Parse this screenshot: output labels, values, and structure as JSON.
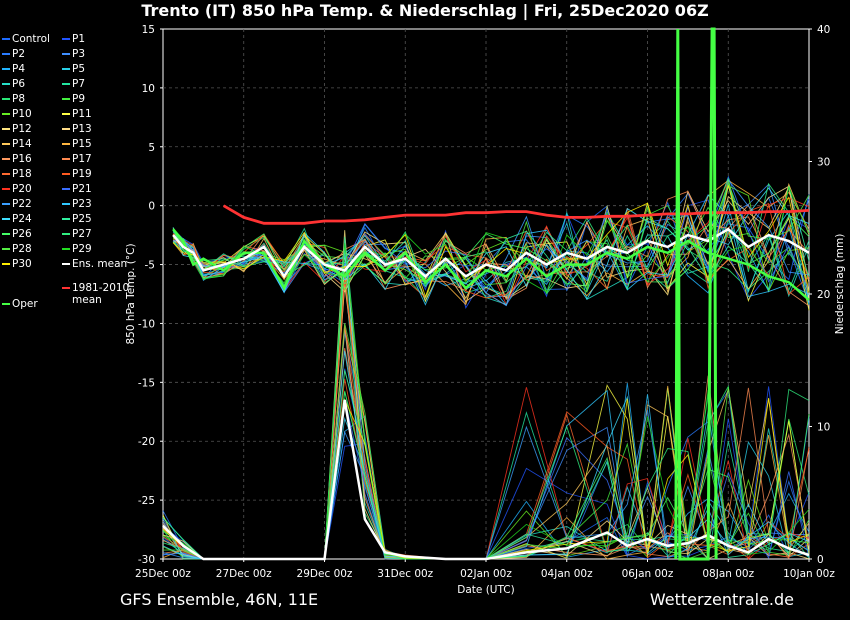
{
  "title": "Trento  (IT)  850 hPa Temp. & Niederschlag | Fri, 25Dec2020 06Z",
  "footer_left": "GFS Ensemble, 46N, 11E",
  "footer_right": "Wetterzentrale.de",
  "legend": [
    {
      "label": "Control",
      "color": "#1e6cff"
    },
    {
      "label": "P1",
      "color": "#2255ff"
    },
    {
      "label": "P2",
      "color": "#2a7cff"
    },
    {
      "label": "P3",
      "color": "#3f8fff"
    },
    {
      "label": "P4",
      "color": "#22b4ff"
    },
    {
      "label": "P5",
      "color": "#2ad0e8"
    },
    {
      "label": "P6",
      "color": "#26e0c8"
    },
    {
      "label": "P7",
      "color": "#22e6a0"
    },
    {
      "label": "P8",
      "color": "#2ae878"
    },
    {
      "label": "P9",
      "color": "#44f040"
    },
    {
      "label": "P10",
      "color": "#66ee22"
    },
    {
      "label": "P11",
      "color": "#ffff44"
    },
    {
      "label": "P12",
      "color": "#ffe680"
    },
    {
      "label": "P13",
      "color": "#ffdd88"
    },
    {
      "label": "P14",
      "color": "#ffc85a"
    },
    {
      "label": "P15",
      "color": "#ffb640"
    },
    {
      "label": "P16",
      "color": "#ff9a60"
    },
    {
      "label": "P17",
      "color": "#ff8a50"
    },
    {
      "label": "P18",
      "color": "#ff6a30"
    },
    {
      "label": "P19",
      "color": "#ff5a20"
    },
    {
      "label": "P20",
      "color": "#ff3320"
    },
    {
      "label": "P21",
      "color": "#3b6fff"
    },
    {
      "label": "P22",
      "color": "#3b9fff"
    },
    {
      "label": "P23",
      "color": "#30c8ff"
    },
    {
      "label": "P24",
      "color": "#40e0ff"
    },
    {
      "label": "P25",
      "color": "#30f0a0"
    },
    {
      "label": "P26",
      "color": "#44ff66"
    },
    {
      "label": "P27",
      "color": "#30ee80"
    },
    {
      "label": "P28",
      "color": "#55ee44"
    },
    {
      "label": "P29",
      "color": "#22dd22"
    },
    {
      "label": "P30",
      "color": "#ffee00"
    },
    {
      "label": "Ens. mean",
      "color": "#ffffff"
    },
    {
      "label": "1981-2010 mean",
      "color": "#ff3333"
    },
    {
      "label": "Oper",
      "color": "#44ff44"
    }
  ],
  "chart_data": {
    "type": "line",
    "xlabel": "Date (UTC)",
    "ylabel": "850 hPa Temp. (°C)",
    "ylabel2": "Niederschlag (mm)",
    "ylim": [
      -30,
      15
    ],
    "ylim2": [
      0,
      40
    ],
    "yticks": [
      "15",
      "10",
      "5",
      "0",
      "-5",
      "-10",
      "-15",
      "-20",
      "-25",
      "-30"
    ],
    "yticks2": [
      "40",
      "30",
      "20",
      "10",
      "0"
    ],
    "xticks": [
      "25Dec 00z",
      "27Dec 00z",
      "29Dec 00z",
      "31Dec 00z",
      "02Jan 00z",
      "04Jan 00z",
      "06Jan 00z",
      "08Jan 00z",
      "10Jan 00z"
    ],
    "x_days_range": [
      0,
      16
    ],
    "grid": true,
    "series": [
      {
        "name": "Ens. mean",
        "axis": "temp",
        "color": "#ffffff",
        "x": [
          0.25,
          0.5,
          0.75,
          1,
          1.5,
          2,
          2.5,
          3,
          3.5,
          4,
          4.5,
          5,
          5.5,
          6,
          6.5,
          7,
          7.5,
          8,
          8.5,
          9,
          9.5,
          10,
          10.5,
          11,
          11.5,
          12,
          12.5,
          13,
          13.5,
          14,
          14.5,
          15,
          15.5,
          16
        ],
        "values": [
          -2.5,
          -3.5,
          -4,
          -5.5,
          -5,
          -4.5,
          -3.5,
          -6,
          -3.5,
          -5,
          -5.5,
          -3.5,
          -5,
          -4.5,
          -6,
          -4.5,
          -6,
          -5,
          -5.5,
          -4,
          -5,
          -4,
          -4.5,
          -3.5,
          -4,
          -3,
          -3.5,
          -2.5,
          -3,
          -2,
          -3.5,
          -2.5,
          -3,
          -4
        ]
      },
      {
        "name": "Oper",
        "axis": "temp",
        "color": "#44ff44",
        "x": [
          0.25,
          0.5,
          0.75,
          1,
          1.5,
          2,
          2.5,
          3,
          3.5,
          4,
          4.5,
          5,
          5.5,
          6,
          6.5,
          7,
          7.5,
          8,
          8.5,
          9,
          9.5,
          10,
          10.5,
          11,
          11.5,
          12,
          12.5,
          13,
          13.5,
          14,
          14.5,
          15,
          15.5,
          16
        ],
        "values": [
          -2,
          -3,
          -5,
          -4.5,
          -5.5,
          -4,
          -4,
          -7,
          -3,
          -5,
          -6,
          -4,
          -5.5,
          -4,
          -6.5,
          -5,
          -7,
          -5.5,
          -6,
          -4.5,
          -6,
          -5,
          -5,
          -4,
          -4.5,
          -3.5,
          -4,
          -3,
          -4,
          -4.5,
          -5,
          -6,
          -6.5,
          -8
        ]
      },
      {
        "name": "1981-2010 mean",
        "axis": "temp",
        "color": "#ff3333",
        "x": [
          1.5,
          2,
          2.5,
          3,
          3.5,
          4,
          4.5,
          5,
          5.5,
          6,
          6.5,
          7,
          7.5,
          8,
          8.5,
          9,
          9.5,
          10,
          10.5,
          11,
          11.5,
          12,
          12.5,
          13,
          13.5,
          14,
          14.5,
          15,
          15.5,
          16
        ],
        "values": [
          0,
          -1,
          -1.5,
          -1.5,
          -1.5,
          -1.3,
          -1.3,
          -1.2,
          -1,
          -0.8,
          -0.8,
          -0.8,
          -0.6,
          -0.6,
          -0.5,
          -0.5,
          -0.8,
          -1,
          -1,
          -0.9,
          -0.9,
          -0.8,
          -0.7,
          -0.7,
          -0.6,
          -0.6,
          -0.6,
          -0.5,
          -0.5,
          -0.4
        ]
      },
      {
        "name": "Ens. mean",
        "axis": "precip",
        "color": "#ffffff",
        "x": [
          0,
          0.5,
          1,
          2,
          3,
          4,
          4.5,
          5,
          5.5,
          6,
          7,
          8,
          9,
          10,
          11,
          11.5,
          12,
          12.5,
          13,
          13.5,
          14,
          14.5,
          15,
          15.5,
          16
        ],
        "values": [
          2.5,
          1,
          0,
          0,
          0,
          0,
          12,
          3,
          0.5,
          0.2,
          0,
          0,
          0.5,
          0.8,
          2,
          1,
          1.5,
          1,
          1.2,
          1.8,
          1,
          0.5,
          1.5,
          0.8,
          0.3
        ]
      }
    ],
    "ensemble_members": 30,
    "spike_series": [
      {
        "name": "Oper",
        "axis": "precip",
        "color": "#44ff44",
        "x": [
          12.7,
          12.75,
          12.8,
          13.5,
          13.6,
          13.65,
          13.7
        ],
        "values": [
          0,
          40,
          0,
          0,
          40,
          40,
          0
        ]
      }
    ]
  }
}
